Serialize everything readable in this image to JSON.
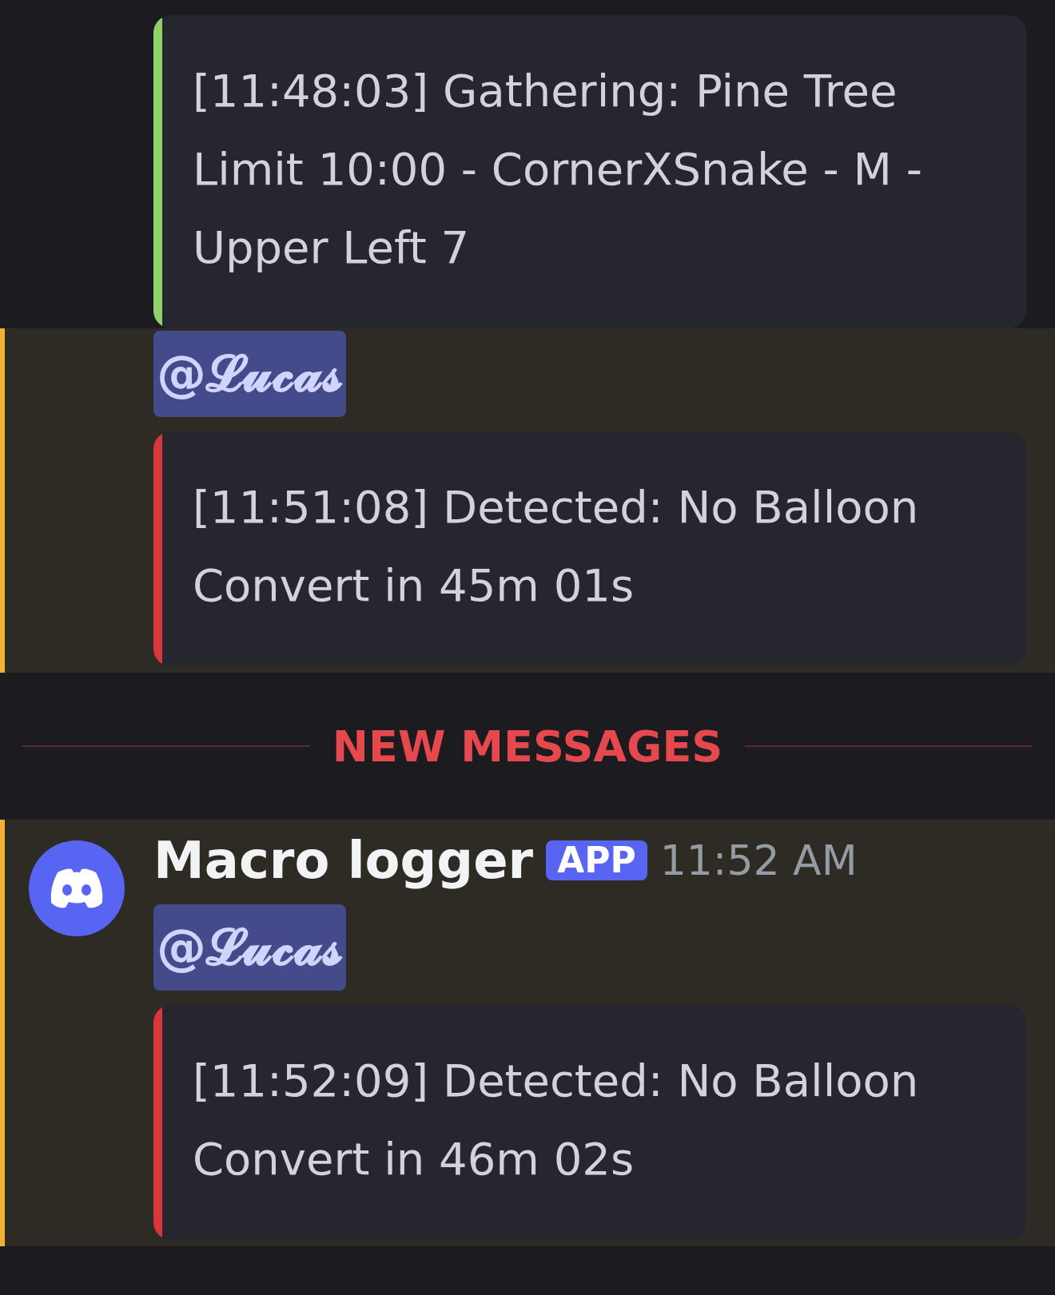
{
  "messages": [
    {
      "kind": "continuation",
      "highlighted": false,
      "embed": {
        "text": "[11:48:03] Gathering: Pine Tree Limit 10:00 - CornerXSnake - M - Upper Left 7",
        "color": "#8fd16a"
      }
    },
    {
      "kind": "continuation",
      "highlighted": true,
      "mention": "@𝓛𝓾𝓬𝓪𝓼",
      "embed": {
        "text": "[11:51:08] Detected: No Balloon Convert in 45m 01s",
        "color": "#da373c"
      }
    },
    {
      "kind": "divider",
      "label": "NEW MESSAGES"
    },
    {
      "kind": "full",
      "highlighted": true,
      "author": "Macro logger",
      "badge": "APP",
      "time": "11:52 AM",
      "mention": "@𝓛𝓾𝓬𝓪𝓼",
      "embed": {
        "text": "[11:52:09] Detected: No Balloon Convert in 46m 02s",
        "color": "#da373c"
      }
    }
  ]
}
